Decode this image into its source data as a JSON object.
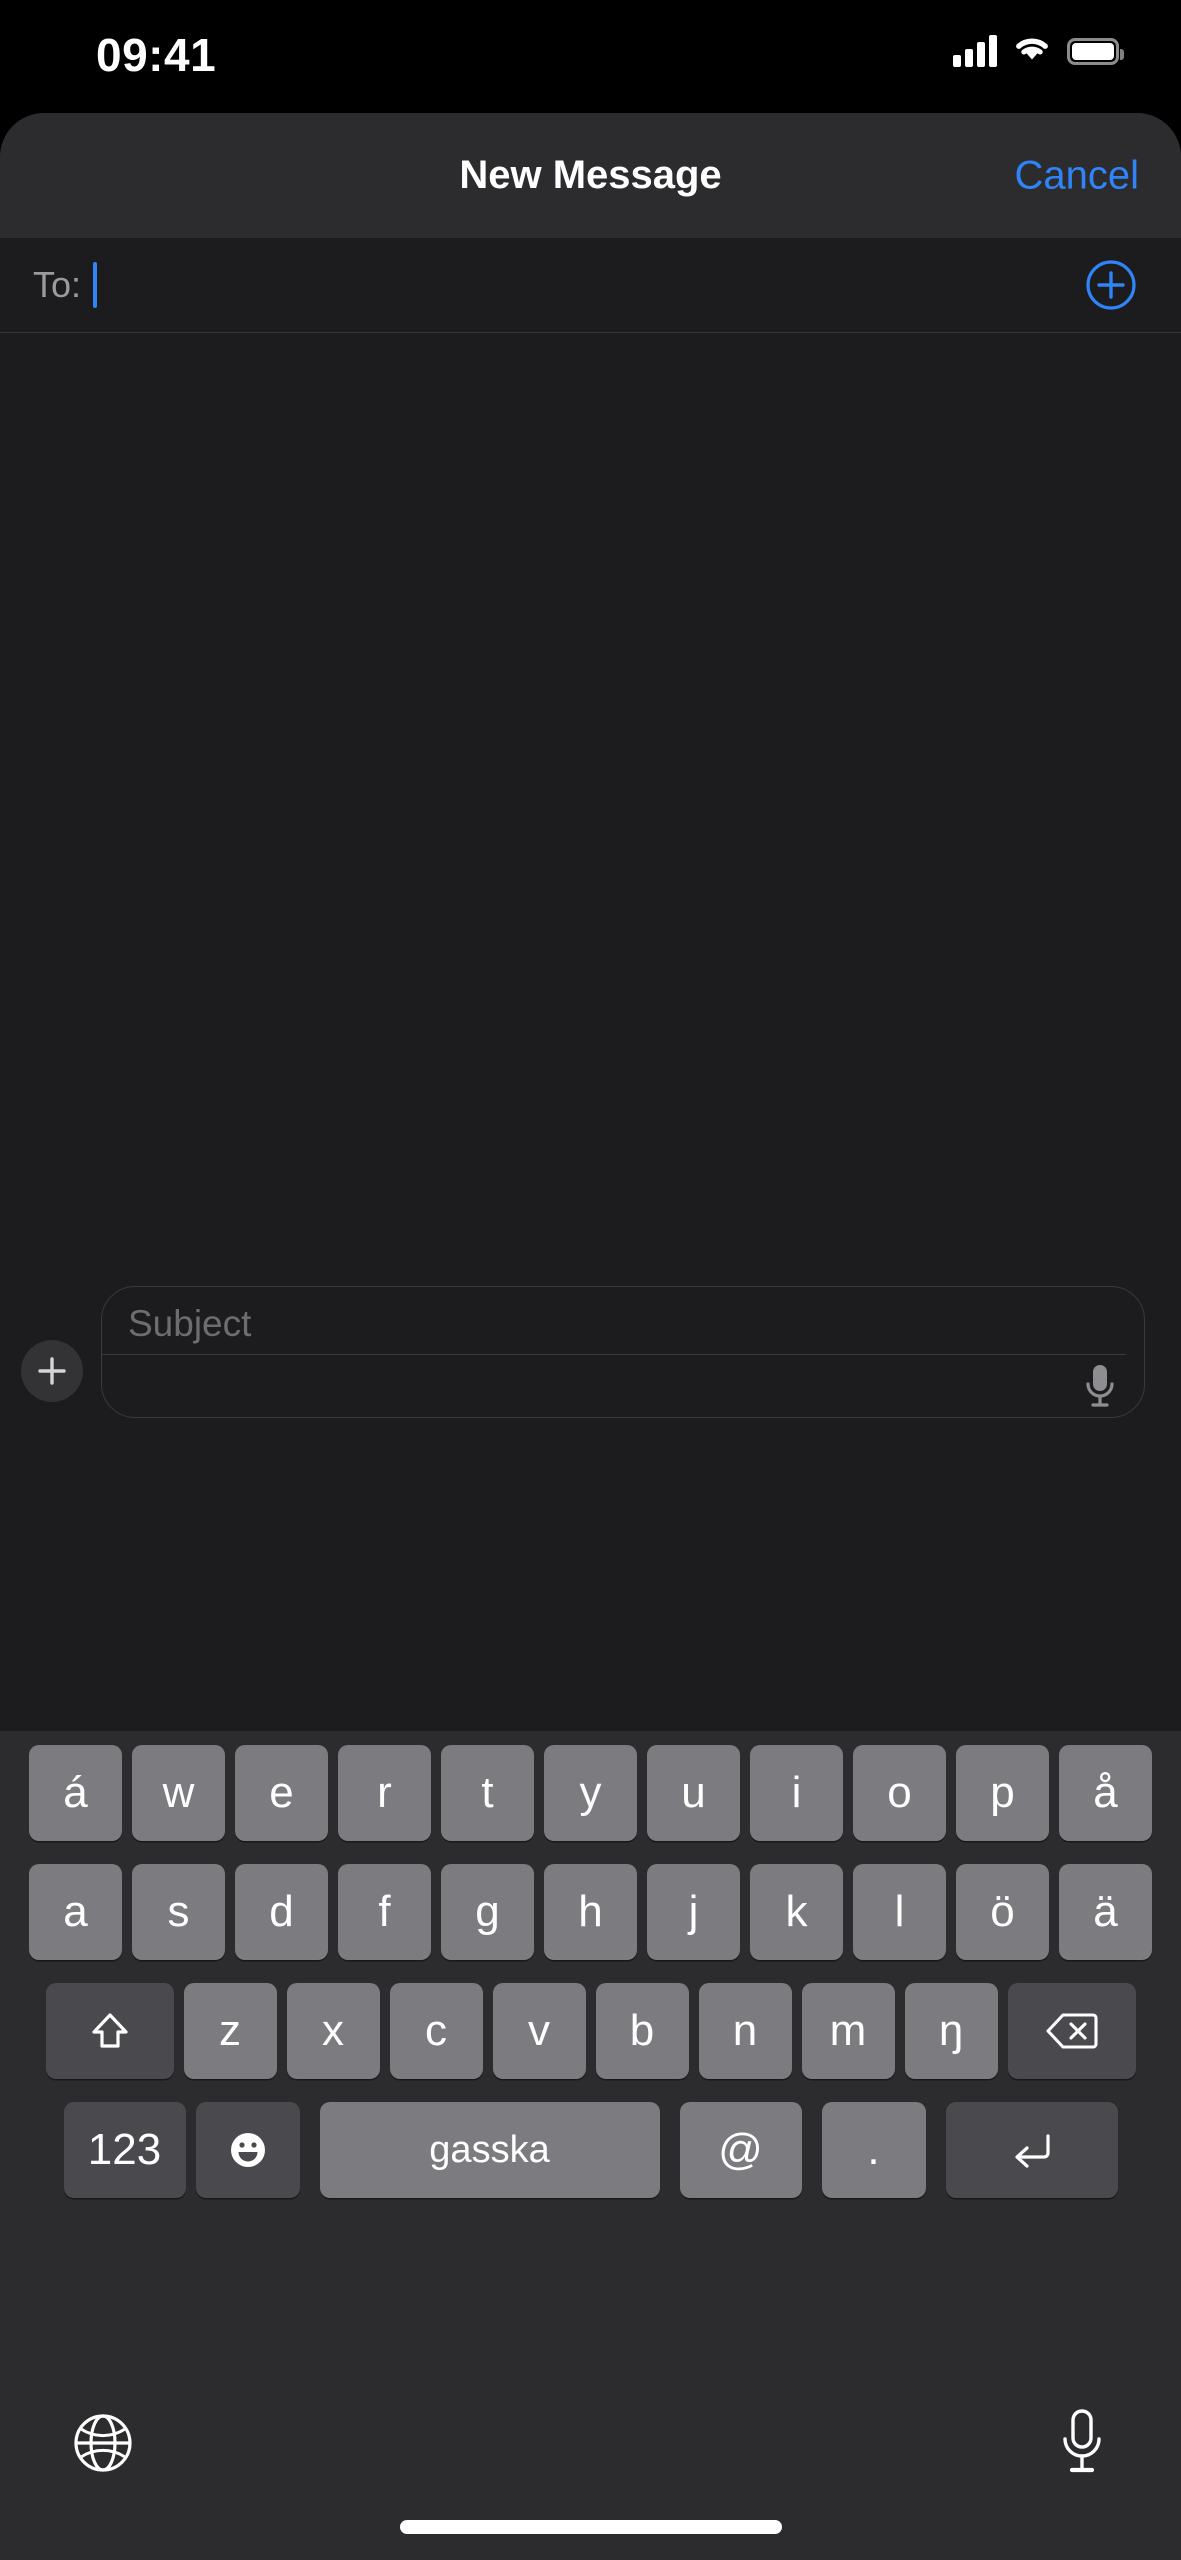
{
  "status_bar": {
    "time": "09:41",
    "signal_icon": "cellular-signal-icon",
    "signal_bars_filled": 4,
    "wifi_icon": "wifi-icon",
    "battery_icon": "battery-icon",
    "battery_level_percent": 100
  },
  "nav_bar": {
    "title": "New Message",
    "cancel_label": "Cancel",
    "cancel_color": "#2f84f7"
  },
  "recipient_field": {
    "label": "To:",
    "value": "",
    "caret_visible": true,
    "caret_color": "#2f84f7",
    "add_contact_icon": "add-contact-plus-circle-icon"
  },
  "compose_bar": {
    "attach_icon": "plus-icon",
    "subject_placeholder": "Subject",
    "subject_value": "",
    "body_value": "",
    "dictation_icon": "microphone-icon"
  },
  "keyboard": {
    "layout_name": "Northern Sami",
    "row1": [
      "á",
      "w",
      "e",
      "r",
      "t",
      "y",
      "u",
      "i",
      "o",
      "p",
      "å"
    ],
    "row2": [
      "a",
      "s",
      "d",
      "f",
      "g",
      "h",
      "j",
      "k",
      "l",
      "ö",
      "ä"
    ],
    "row3_letters": [
      "z",
      "x",
      "c",
      "v",
      "b",
      "n",
      "m",
      "ŋ"
    ],
    "shift_icon": "shift-arrow-icon",
    "backspace_icon": "backspace-delete-icon",
    "numbers_label": "123",
    "emoji_icon": "emoji-smiley-icon",
    "space_label": "gasska",
    "at_label": "@",
    "period_label": ".",
    "return_icon": "return-enter-icon",
    "globe_icon": "globe-language-icon",
    "dictation_icon": "microphone-icon"
  },
  "home_indicator": {
    "name": "home-indicator-bar"
  },
  "colors": {
    "accent_blue": "#2f84f7",
    "sheet_bg": "#1c1c1e",
    "nav_bg": "#2c2c2e",
    "keyboard_bg": "#2c2c2e",
    "key_light": "#7c7c80",
    "key_dark": "#4a4a4e"
  }
}
